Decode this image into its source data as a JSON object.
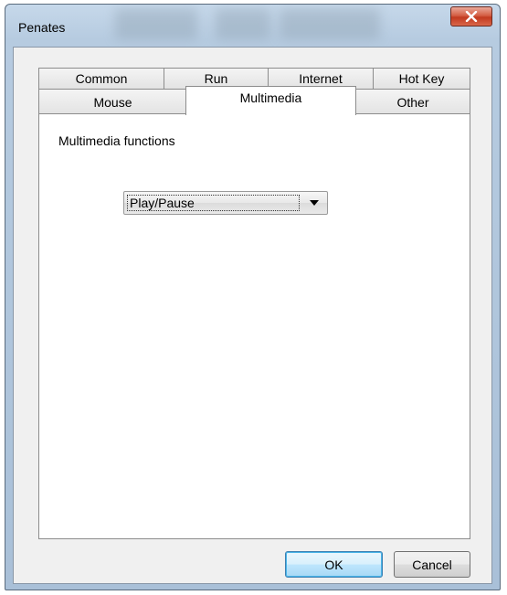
{
  "window": {
    "title": "Penates"
  },
  "tabs": {
    "row1": [
      "Common",
      "Run",
      "Internet",
      "Hot Key"
    ],
    "row2": [
      "Mouse",
      "Multimedia",
      "Other"
    ],
    "active": "Multimedia"
  },
  "panel": {
    "label": "Multimedia functions",
    "dropdown": {
      "selected": "Play/Pause"
    }
  },
  "buttons": {
    "ok": "OK",
    "cancel": "Cancel"
  },
  "colors": {
    "close": "#c23a1f",
    "default_button_border": "#3c7fb1"
  }
}
